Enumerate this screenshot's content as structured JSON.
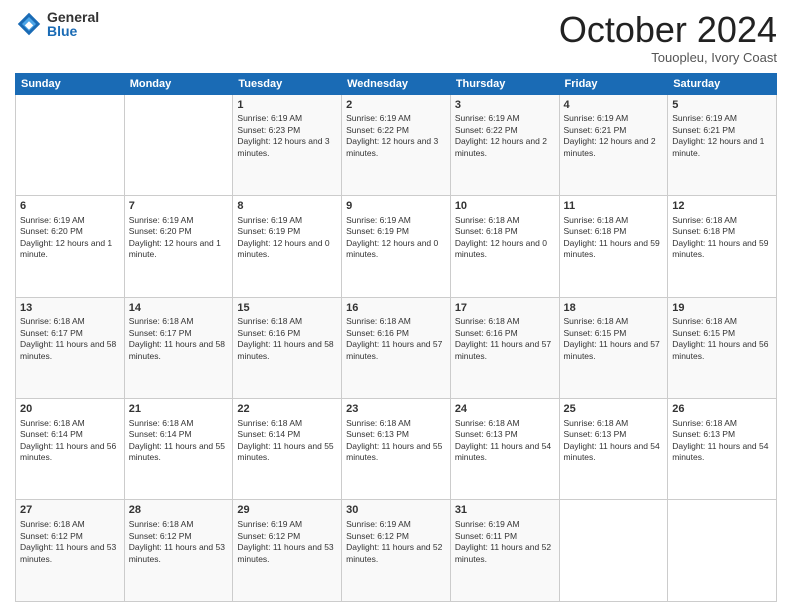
{
  "logo": {
    "general": "General",
    "blue": "Blue"
  },
  "header": {
    "month": "October 2024",
    "location": "Touopleu, Ivory Coast"
  },
  "weekdays": [
    "Sunday",
    "Monday",
    "Tuesday",
    "Wednesday",
    "Thursday",
    "Friday",
    "Saturday"
  ],
  "weeks": [
    [
      {
        "day": "",
        "info": ""
      },
      {
        "day": "",
        "info": ""
      },
      {
        "day": "1",
        "info": "Sunrise: 6:19 AM\nSunset: 6:23 PM\nDaylight: 12 hours and 3 minutes."
      },
      {
        "day": "2",
        "info": "Sunrise: 6:19 AM\nSunset: 6:22 PM\nDaylight: 12 hours and 3 minutes."
      },
      {
        "day": "3",
        "info": "Sunrise: 6:19 AM\nSunset: 6:22 PM\nDaylight: 12 hours and 2 minutes."
      },
      {
        "day": "4",
        "info": "Sunrise: 6:19 AM\nSunset: 6:21 PM\nDaylight: 12 hours and 2 minutes."
      },
      {
        "day": "5",
        "info": "Sunrise: 6:19 AM\nSunset: 6:21 PM\nDaylight: 12 hours and 1 minute."
      }
    ],
    [
      {
        "day": "6",
        "info": "Sunrise: 6:19 AM\nSunset: 6:20 PM\nDaylight: 12 hours and 1 minute."
      },
      {
        "day": "7",
        "info": "Sunrise: 6:19 AM\nSunset: 6:20 PM\nDaylight: 12 hours and 1 minute."
      },
      {
        "day": "8",
        "info": "Sunrise: 6:19 AM\nSunset: 6:19 PM\nDaylight: 12 hours and 0 minutes."
      },
      {
        "day": "9",
        "info": "Sunrise: 6:19 AM\nSunset: 6:19 PM\nDaylight: 12 hours and 0 minutes."
      },
      {
        "day": "10",
        "info": "Sunrise: 6:18 AM\nSunset: 6:18 PM\nDaylight: 12 hours and 0 minutes."
      },
      {
        "day": "11",
        "info": "Sunrise: 6:18 AM\nSunset: 6:18 PM\nDaylight: 11 hours and 59 minutes."
      },
      {
        "day": "12",
        "info": "Sunrise: 6:18 AM\nSunset: 6:18 PM\nDaylight: 11 hours and 59 minutes."
      }
    ],
    [
      {
        "day": "13",
        "info": "Sunrise: 6:18 AM\nSunset: 6:17 PM\nDaylight: 11 hours and 58 minutes."
      },
      {
        "day": "14",
        "info": "Sunrise: 6:18 AM\nSunset: 6:17 PM\nDaylight: 11 hours and 58 minutes."
      },
      {
        "day": "15",
        "info": "Sunrise: 6:18 AM\nSunset: 6:16 PM\nDaylight: 11 hours and 58 minutes."
      },
      {
        "day": "16",
        "info": "Sunrise: 6:18 AM\nSunset: 6:16 PM\nDaylight: 11 hours and 57 minutes."
      },
      {
        "day": "17",
        "info": "Sunrise: 6:18 AM\nSunset: 6:16 PM\nDaylight: 11 hours and 57 minutes."
      },
      {
        "day": "18",
        "info": "Sunrise: 6:18 AM\nSunset: 6:15 PM\nDaylight: 11 hours and 57 minutes."
      },
      {
        "day": "19",
        "info": "Sunrise: 6:18 AM\nSunset: 6:15 PM\nDaylight: 11 hours and 56 minutes."
      }
    ],
    [
      {
        "day": "20",
        "info": "Sunrise: 6:18 AM\nSunset: 6:14 PM\nDaylight: 11 hours and 56 minutes."
      },
      {
        "day": "21",
        "info": "Sunrise: 6:18 AM\nSunset: 6:14 PM\nDaylight: 11 hours and 55 minutes."
      },
      {
        "day": "22",
        "info": "Sunrise: 6:18 AM\nSunset: 6:14 PM\nDaylight: 11 hours and 55 minutes."
      },
      {
        "day": "23",
        "info": "Sunrise: 6:18 AM\nSunset: 6:13 PM\nDaylight: 11 hours and 55 minutes."
      },
      {
        "day": "24",
        "info": "Sunrise: 6:18 AM\nSunset: 6:13 PM\nDaylight: 11 hours and 54 minutes."
      },
      {
        "day": "25",
        "info": "Sunrise: 6:18 AM\nSunset: 6:13 PM\nDaylight: 11 hours and 54 minutes."
      },
      {
        "day": "26",
        "info": "Sunrise: 6:18 AM\nSunset: 6:13 PM\nDaylight: 11 hours and 54 minutes."
      }
    ],
    [
      {
        "day": "27",
        "info": "Sunrise: 6:18 AM\nSunset: 6:12 PM\nDaylight: 11 hours and 53 minutes."
      },
      {
        "day": "28",
        "info": "Sunrise: 6:18 AM\nSunset: 6:12 PM\nDaylight: 11 hours and 53 minutes."
      },
      {
        "day": "29",
        "info": "Sunrise: 6:19 AM\nSunset: 6:12 PM\nDaylight: 11 hours and 53 minutes."
      },
      {
        "day": "30",
        "info": "Sunrise: 6:19 AM\nSunset: 6:12 PM\nDaylight: 11 hours and 52 minutes."
      },
      {
        "day": "31",
        "info": "Sunrise: 6:19 AM\nSunset: 6:11 PM\nDaylight: 11 hours and 52 minutes."
      },
      {
        "day": "",
        "info": ""
      },
      {
        "day": "",
        "info": ""
      }
    ]
  ]
}
